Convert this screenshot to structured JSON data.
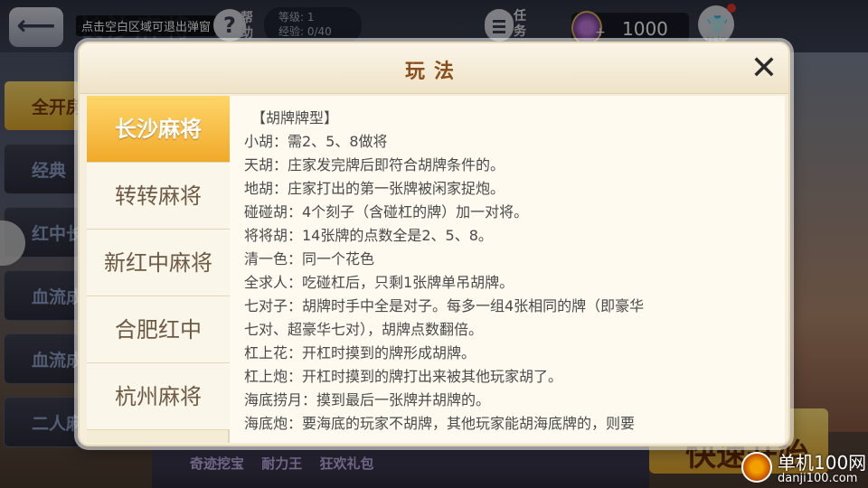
{
  "header": {
    "back_glyph": "⟵",
    "title_ghost": "长沙麻将",
    "tooltip": "点击空白区域可退出弹窗",
    "help_glyph": "?",
    "help_label": "帮助",
    "level_label": "等级: 1",
    "exp_label": "经验: 0/40",
    "task_label": "任务",
    "coin_plus": "+",
    "coin_value": "1000",
    "shirt_label": "装扮"
  },
  "left_tabs": [
    "全开房",
    "经典",
    "红中长",
    "血流成",
    "血流成",
    "二人麻"
  ],
  "bottom_items": [
    "奇迹挖宝",
    "耐力王",
    "狂欢礼包"
  ],
  "start_button": "快速开始",
  "watermark": {
    "cn": "单机100网",
    "en": "danji100.com"
  },
  "dialog": {
    "title": "玩法",
    "close_glyph": "✕",
    "tabs": [
      {
        "label": "长沙麻将",
        "active": true
      },
      {
        "label": "转转麻将",
        "active": false
      },
      {
        "label": "新红中麻将",
        "active": false
      },
      {
        "label": "合肥红中",
        "active": false
      },
      {
        "label": "杭州麻将",
        "active": false
      }
    ],
    "content": {
      "heading": "【胡牌牌型】",
      "lines": [
        "小胡：需2、5、8做将",
        "天胡：庄家发完牌后即符合胡牌条件的。",
        "地胡：庄家打出的第一张牌被闲家捉炮。",
        "碰碰胡：4个刻子（含碰杠的牌）加一对将。",
        "将将胡：14张牌的点数全是2、5、8。",
        "清一色：同一个花色",
        "全求人：吃碰杠后，只剩1张牌单吊胡牌。",
        "七对子：胡牌时手中全是对子。每多一组4张相同的牌（即豪华",
        "七对、超豪华七对），胡牌点数翻倍。",
        "杠上花：开杠时摸到的牌形成胡牌。",
        "杠上炮：开杠时摸到的牌打出来被其他玩家胡了。",
        "海底捞月：摸到最后一张牌并胡牌的。",
        "海底炮：要海底的玩家不胡牌，其他玩家能胡海底牌的，则要"
      ]
    }
  }
}
